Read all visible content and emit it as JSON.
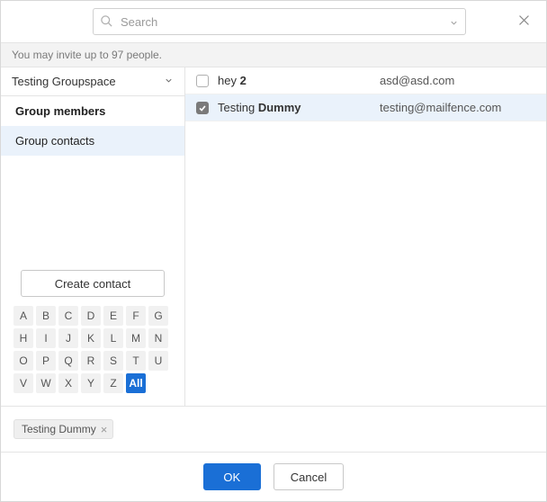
{
  "search": {
    "placeholder": "Search"
  },
  "info": {
    "text": "You may invite up to 97 people."
  },
  "sidebar": {
    "group_select": {
      "label": "Testing Groupspace"
    },
    "nav": [
      {
        "label": "Group members",
        "bold": true,
        "active": false
      },
      {
        "label": "Group contacts",
        "bold": false,
        "active": true
      }
    ],
    "create_label": "Create contact",
    "alphabet": [
      "A",
      "B",
      "C",
      "D",
      "E",
      "F",
      "G",
      "H",
      "I",
      "J",
      "K",
      "L",
      "M",
      "N",
      "O",
      "P",
      "Q",
      "R",
      "S",
      "T",
      "U",
      "V",
      "W",
      "X",
      "Y",
      "Z",
      "All"
    ]
  },
  "contacts": [
    {
      "name_prefix": "hey ",
      "name_bold": "2",
      "email": "asd@asd.com",
      "checked": false,
      "selected": false
    },
    {
      "name_prefix": "Testing ",
      "name_bold": "Dummy",
      "email": "testing@mailfence.com",
      "checked": true,
      "selected": true
    }
  ],
  "chips": [
    {
      "label": "Testing Dummy"
    }
  ],
  "footer": {
    "ok": "OK",
    "cancel": "Cancel"
  }
}
